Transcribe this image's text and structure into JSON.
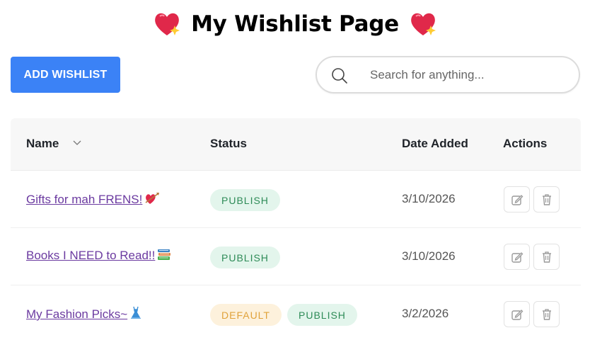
{
  "header": {
    "title": "My Wishlist Page"
  },
  "toolbar": {
    "add_label": "ADD WISHLIST"
  },
  "search": {
    "placeholder": "Search for anything..."
  },
  "table": {
    "columns": [
      "Name",
      "Status",
      "Date Added",
      "Actions"
    ],
    "rows": [
      {
        "name": "Gifts for mah FRENS!",
        "emoji": "heart-arrow-emoji",
        "statuses": [
          "PUBLISH"
        ],
        "date": "3/10/2026"
      },
      {
        "name": "Books I NEED to Read!!",
        "emoji": "books-emoji",
        "statuses": [
          "PUBLISH"
        ],
        "date": "3/10/2026"
      },
      {
        "name": "My Fashion Picks~",
        "emoji": "dress-emoji",
        "statuses": [
          "DEFAULT",
          "PUBLISH"
        ],
        "date": "3/2/2026"
      }
    ]
  },
  "colors": {
    "primary": "#3b82f6",
    "publish_bg": "#e3f5ec",
    "publish_text": "#2e8b57",
    "default_bg": "#fdf1dc",
    "default_text": "#e0a23a",
    "link": "#6b3aa0"
  }
}
